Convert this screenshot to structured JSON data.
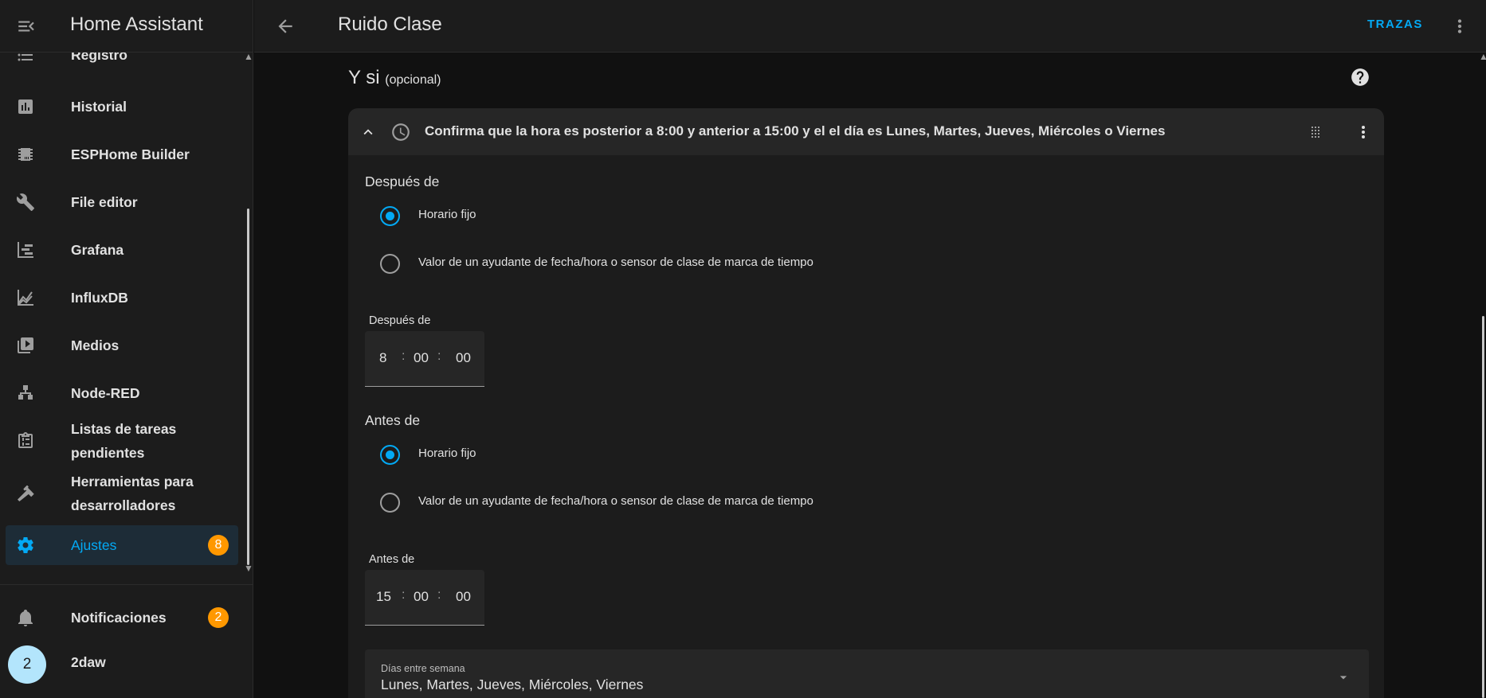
{
  "sidebar": {
    "app_title": "Home Assistant",
    "items": [
      {
        "label": "Registro",
        "icon": "format-list-bulleted-icon"
      },
      {
        "label": "Historial",
        "icon": "chart-box-icon"
      },
      {
        "label": "ESPHome Builder",
        "icon": "chip-icon"
      },
      {
        "label": "File editor",
        "icon": "wrench-icon"
      },
      {
        "label": "Grafana",
        "icon": "chart-timeline-icon"
      },
      {
        "label": "InfluxDB",
        "icon": "chart-areaspline-icon"
      },
      {
        "label": "Medios",
        "icon": "play-box-multiple-icon"
      },
      {
        "label": "Node-RED",
        "icon": "sitemap-icon"
      },
      {
        "label": "Listas de tareas pendientes",
        "icon": "clipboard-list-icon"
      },
      {
        "label": "Herramientas para desarrolladores",
        "icon": "hammer-icon"
      },
      {
        "label": "Ajustes",
        "icon": "cog-icon",
        "badge": "8",
        "active": true
      }
    ],
    "notifications": {
      "label": "Notificaciones",
      "badge": "2"
    },
    "user": {
      "label": "2daw",
      "avatar_initial": "2"
    }
  },
  "header": {
    "title": "Ruido Clase",
    "traces_label": "TRAZAS"
  },
  "section": {
    "title": "Y si",
    "optional": "(opcional)"
  },
  "condition": {
    "summary": "Confirma que la hora es posterior a 8:00 y anterior a 15:00 y el el día es Lunes, Martes, Jueves, Miércoles o Viernes",
    "after": {
      "group_label": "Después de",
      "option_fixed": "Horario fijo",
      "option_helper": "Valor de un ayudante de fecha/hora o sensor de clase de marca de tiempo",
      "selected": "fixed",
      "time_label": "Después de",
      "hours": "8",
      "minutes": "00",
      "seconds": "00"
    },
    "before": {
      "group_label": "Antes de",
      "option_fixed": "Horario fijo",
      "option_helper": "Valor de un ayudante de fecha/hora o sensor de clase de marca de tiempo",
      "selected": "fixed",
      "time_label": "Antes de",
      "hours": "15",
      "minutes": "00",
      "seconds": "00"
    },
    "weekdays": {
      "label": "Días entre semana",
      "value": "Lunes, Martes, Jueves, Miércoles, Viernes"
    }
  },
  "colors": {
    "accent": "#03a9f4",
    "badge": "#ff9800",
    "background": "#111111",
    "card": "#1c1c1c"
  }
}
